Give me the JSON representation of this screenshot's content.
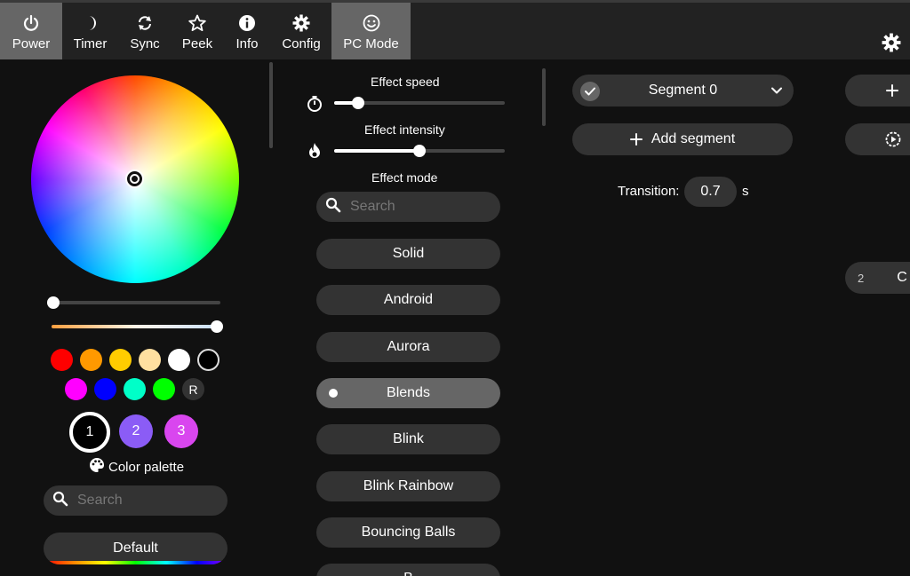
{
  "nav": {
    "items": [
      {
        "label": "Power"
      },
      {
        "label": "Timer"
      },
      {
        "label": "Sync"
      },
      {
        "label": "Peek"
      },
      {
        "label": "Info"
      },
      {
        "label": "Config"
      },
      {
        "label": "PC Mode"
      }
    ]
  },
  "colors": {
    "swatches_row1": [
      "#ff0000",
      "#ff9900",
      "#ffcc00",
      "#ffe0a0",
      "#ffffff",
      "#000000"
    ],
    "swatches_row2": [
      "#ff00ff",
      "#0000ff",
      "#00ffc8",
      "#00ff00"
    ],
    "random_label": "R",
    "slots": [
      {
        "label": "1",
        "color": "#000000"
      },
      {
        "label": "2",
        "color": "#8b5cf6"
      },
      {
        "label": "3",
        "color": "#d946ef"
      }
    ],
    "palette_label": "Color palette",
    "search_placeholder": "Search",
    "palette_selected": "Default"
  },
  "effects": {
    "speed_label": "Effect speed",
    "intensity_label": "Effect intensity",
    "mode_label": "Effect mode",
    "search_placeholder": "Search",
    "list": [
      "Solid",
      "Android",
      "Aurora",
      "Blends",
      "Blink",
      "Blink Rainbow",
      "Bouncing Balls",
      "B"
    ],
    "selected": "Blends",
    "speed_value": 0.14,
    "intensity_value": 0.5
  },
  "segments": {
    "segment_name": "Segment 0",
    "add_label": "Add segment",
    "transition_label": "Transition:",
    "transition_value": "0.7",
    "transition_unit": "s"
  },
  "right_partial": {
    "preset_number": "2",
    "preset_letter": "C"
  }
}
